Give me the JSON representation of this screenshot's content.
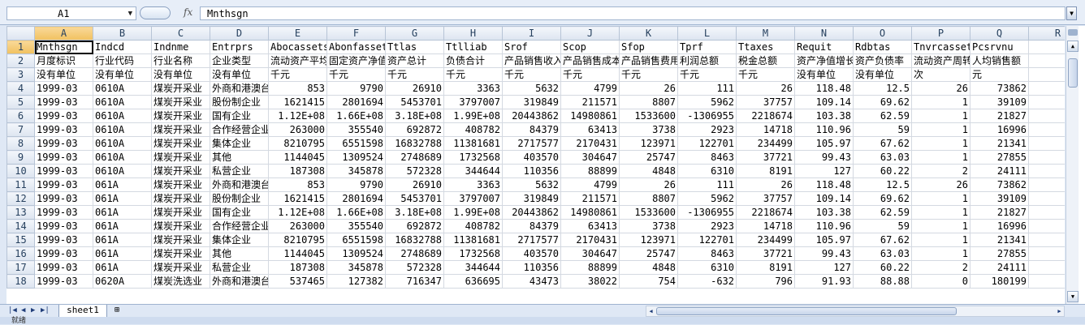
{
  "formula_bar": {
    "name_box": "A1",
    "fx_label": "fx",
    "formula": "Mnthsgn"
  },
  "columns": [
    "A",
    "B",
    "C",
    "D",
    "E",
    "F",
    "G",
    "H",
    "I",
    "J",
    "K",
    "L",
    "M",
    "N",
    "O",
    "P",
    "Q",
    "R"
  ],
  "rows": [
    {
      "n": "1",
      "cells": [
        "Mnthsgn",
        "Indcd",
        "Indnme",
        "Entrprs",
        "Abocassets",
        "Abonfassets",
        "Ttlas",
        "Ttlliab",
        "Srof",
        "Scop",
        "Sfop",
        "Tprf",
        "Ttaxes",
        "Requit",
        "Rdbtas",
        "Tnvrcassets",
        "Pcsrvnu",
        ""
      ]
    },
    {
      "n": "2",
      "cells": [
        "月度标识",
        "行业代码",
        "行业名称",
        "企业类型",
        "流动资产平均余额",
        "固定资产净值平均余额",
        "资产总计",
        "负债合计",
        "产品销售收入",
        "产品销售成本",
        "产品销售费用",
        "利润总额",
        "税金总额",
        "资产净值增长率",
        "资产负债率",
        "流动资产周转次数",
        "人均销售额",
        ""
      ]
    },
    {
      "n": "3",
      "cells": [
        "没有单位",
        "没有单位",
        "没有单位",
        "没有单位",
        "千元",
        "千元",
        "千元",
        "千元",
        "千元",
        "千元",
        "千元",
        "千元",
        "千元",
        "没有单位",
        "没有单位",
        "次",
        "元",
        ""
      ]
    },
    {
      "n": "4",
      "cells": [
        "1999-03",
        "0610A",
        "煤炭开采业",
        "外商和港澳台",
        "853",
        "9790",
        "26910",
        "3363",
        "5632",
        "4799",
        "26",
        "111",
        "26",
        "118.48",
        "12.5",
        "26",
        "73862",
        ""
      ]
    },
    {
      "n": "5",
      "cells": [
        "1999-03",
        "0610A",
        "煤炭开采业",
        "股份制企业",
        "1621415",
        "2801694",
        "5453701",
        "3797007",
        "319849",
        "211571",
        "8807",
        "5962",
        "37757",
        "109.14",
        "69.62",
        "1",
        "39109",
        ""
      ]
    },
    {
      "n": "6",
      "cells": [
        "1999-03",
        "0610A",
        "煤炭开采业",
        "国有企业",
        "1.12E+08",
        "1.66E+08",
        "3.18E+08",
        "1.99E+08",
        "20443862",
        "14980861",
        "1533600",
        "-1306955",
        "2218674",
        "103.38",
        "62.59",
        "1",
        "21827",
        ""
      ]
    },
    {
      "n": "7",
      "cells": [
        "1999-03",
        "0610A",
        "煤炭开采业",
        "合作经营企业",
        "263000",
        "355540",
        "692872",
        "408782",
        "84379",
        "63413",
        "3738",
        "2923",
        "14718",
        "110.96",
        "59",
        "1",
        "16996",
        ""
      ]
    },
    {
      "n": "8",
      "cells": [
        "1999-03",
        "0610A",
        "煤炭开采业",
        "集体企业",
        "8210795",
        "6551598",
        "16832788",
        "11381681",
        "2717577",
        "2170431",
        "123971",
        "122701",
        "234499",
        "105.97",
        "67.62",
        "1",
        "21341",
        ""
      ]
    },
    {
      "n": "9",
      "cells": [
        "1999-03",
        "0610A",
        "煤炭开采业",
        "其他",
        "1144045",
        "1309524",
        "2748689",
        "1732568",
        "403570",
        "304647",
        "25747",
        "8463",
        "37721",
        "99.43",
        "63.03",
        "1",
        "27855",
        ""
      ]
    },
    {
      "n": "10",
      "cells": [
        "1999-03",
        "0610A",
        "煤炭开采业",
        "私营企业",
        "187308",
        "345878",
        "572328",
        "344644",
        "110356",
        "88899",
        "4848",
        "6310",
        "8191",
        "127",
        "60.22",
        "2",
        "24111",
        ""
      ]
    },
    {
      "n": "11",
      "cells": [
        "1999-03",
        "061A",
        "煤炭开采业",
        "外商和港澳台",
        "853",
        "9790",
        "26910",
        "3363",
        "5632",
        "4799",
        "26",
        "111",
        "26",
        "118.48",
        "12.5",
        "26",
        "73862",
        ""
      ]
    },
    {
      "n": "12",
      "cells": [
        "1999-03",
        "061A",
        "煤炭开采业",
        "股份制企业",
        "1621415",
        "2801694",
        "5453701",
        "3797007",
        "319849",
        "211571",
        "8807",
        "5962",
        "37757",
        "109.14",
        "69.62",
        "1",
        "39109",
        ""
      ]
    },
    {
      "n": "13",
      "cells": [
        "1999-03",
        "061A",
        "煤炭开采业",
        "国有企业",
        "1.12E+08",
        "1.66E+08",
        "3.18E+08",
        "1.99E+08",
        "20443862",
        "14980861",
        "1533600",
        "-1306955",
        "2218674",
        "103.38",
        "62.59",
        "1",
        "21827",
        ""
      ]
    },
    {
      "n": "14",
      "cells": [
        "1999-03",
        "061A",
        "煤炭开采业",
        "合作经营企业",
        "263000",
        "355540",
        "692872",
        "408782",
        "84379",
        "63413",
        "3738",
        "2923",
        "14718",
        "110.96",
        "59",
        "1",
        "16996",
        ""
      ]
    },
    {
      "n": "15",
      "cells": [
        "1999-03",
        "061A",
        "煤炭开采业",
        "集体企业",
        "8210795",
        "6551598",
        "16832788",
        "11381681",
        "2717577",
        "2170431",
        "123971",
        "122701",
        "234499",
        "105.97",
        "67.62",
        "1",
        "21341",
        ""
      ]
    },
    {
      "n": "16",
      "cells": [
        "1999-03",
        "061A",
        "煤炭开采业",
        "其他",
        "1144045",
        "1309524",
        "2748689",
        "1732568",
        "403570",
        "304647",
        "25747",
        "8463",
        "37721",
        "99.43",
        "63.03",
        "1",
        "27855",
        ""
      ]
    },
    {
      "n": "17",
      "cells": [
        "1999-03",
        "061A",
        "煤炭开采业",
        "私营企业",
        "187308",
        "345878",
        "572328",
        "344644",
        "110356",
        "88899",
        "4848",
        "6310",
        "8191",
        "127",
        "60.22",
        "2",
        "24111",
        ""
      ]
    },
    {
      "n": "18",
      "cells": [
        "1999-03",
        "0620A",
        "煤炭洗选业",
        "外商和港澳台",
        "537465",
        "127382",
        "716347",
        "636695",
        "43473",
        "38022",
        "754",
        "-632",
        "796",
        "91.93",
        "88.88",
        "0",
        "180199",
        ""
      ]
    }
  ],
  "sheet_tabs": [
    {
      "label": "sheet1",
      "active": true
    }
  ],
  "status": {
    "text": "就绪"
  }
}
